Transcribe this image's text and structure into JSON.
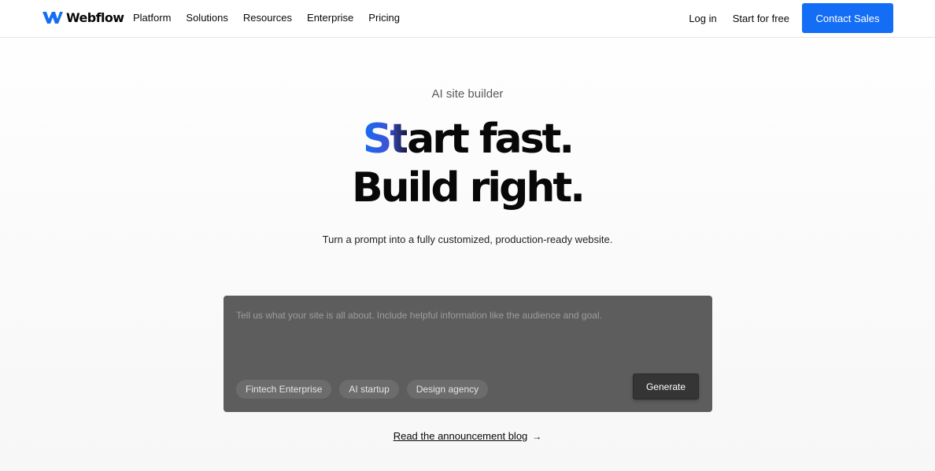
{
  "brand": {
    "name": "Webflow",
    "accent_color": "#146ef5"
  },
  "nav": {
    "links": [
      "Platform",
      "Solutions",
      "Resources",
      "Enterprise",
      "Pricing"
    ],
    "login": "Log in",
    "start_free": "Start for free",
    "contact_sales": "Contact Sales"
  },
  "hero": {
    "eyebrow": "AI site builder",
    "headline_accent": "St",
    "headline_line1_rest": "art fast.",
    "headline_line2": "Build right.",
    "subtitle": "Turn a prompt into a fully customized, production-ready website."
  },
  "prompt": {
    "placeholder": "Tell us what your site is all about. Include helpful information like the audience and goal.",
    "chips": [
      "Fintech Enterprise",
      "AI startup",
      "Design agency"
    ],
    "generate_label": "Generate"
  },
  "announcement": {
    "link_text": "Read the announcement blog",
    "arrow": "→"
  }
}
